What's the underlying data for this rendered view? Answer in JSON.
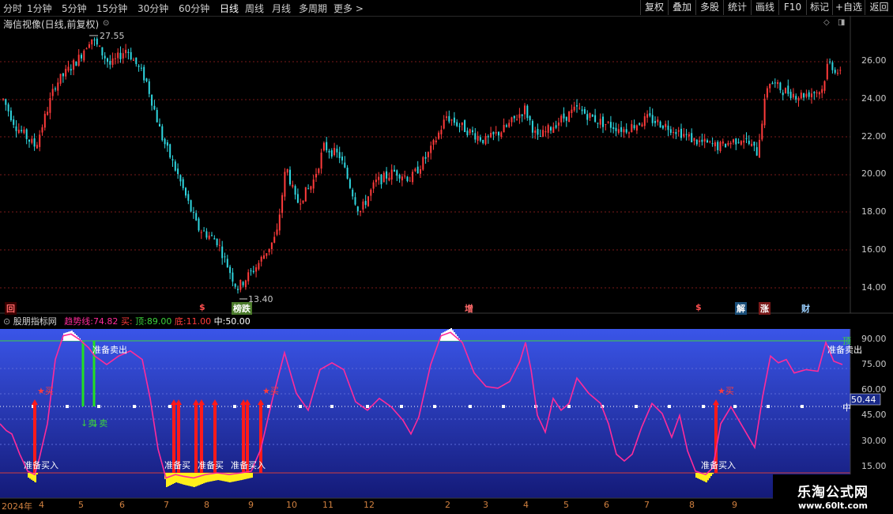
{
  "toolbar": {
    "timeframes": [
      "分时",
      "1分钟",
      "5分钟",
      "15分钟",
      "30分钟",
      "60分钟",
      "日线",
      "周线",
      "月线",
      "多周期",
      "更多 >"
    ],
    "active": "日线",
    "right_buttons": [
      "复权",
      "叠加",
      "多股",
      "统计",
      "画线",
      "F10",
      "标记",
      "+自选",
      "返回"
    ]
  },
  "main_pane": {
    "title": "海信视像(日线,前复权)",
    "high_label": "27.55",
    "low_label": "13.40",
    "y_ticks": [
      "26.00",
      "24.00",
      "22.00",
      "20.00",
      "18.00",
      "16.00",
      "14.00"
    ],
    "up_color": "#ff3b3b",
    "down_color": "#2fd7e0"
  },
  "events": [
    {
      "text": "回",
      "color": "#ff6a6a",
      "bg": "#3b0000"
    },
    {
      "text": "$",
      "color": "#ff5050",
      "bg": ""
    },
    {
      "text": "榜跌",
      "color": "#ffffff",
      "bg": "#4a7a2a"
    },
    {
      "text": "增",
      "color": "#ff6a6a",
      "bg": ""
    },
    {
      "text": "$",
      "color": "#ff5050",
      "bg": ""
    },
    {
      "text": "解",
      "color": "#ffffff",
      "bg": "#1a4f7a"
    },
    {
      "text": "涨",
      "color": "#ffffff",
      "bg": "#7a1a1a"
    },
    {
      "text": "财",
      "color": "#9ad0ff",
      "bg": ""
    }
  ],
  "indicator": {
    "name": "股朋指标网",
    "trend_label": "趋势线:",
    "trend_value": "74.82",
    "buy_label": "买:",
    "top_label": "顶:",
    "top_value": "89.00",
    "bottom_label": "底:",
    "bottom_value": "11.00",
    "mid_label": "中:",
    "mid_value": "50.00",
    "y_ticks": [
      "90.00",
      "75.00",
      "60.00",
      "45.00",
      "30.00",
      "15.00"
    ],
    "current_value": "50.44",
    "right_top": "顶",
    "right_mid": "中",
    "annotations": {
      "prepare_sell": "准备卖出",
      "sell": "卖",
      "prepare_buy": "准备买入",
      "buy": "买",
      "prepare_buy_short": "准备买"
    }
  },
  "x_axis": [
    "2024年",
    "4",
    "5",
    "6",
    "7",
    "8",
    "9",
    "10",
    "11",
    "12",
    "2",
    "3",
    "4",
    "5",
    "6",
    "7",
    "8",
    "9"
  ],
  "watermark": {
    "title": "乐淘公式网",
    "url": "www.60lt.com"
  }
}
